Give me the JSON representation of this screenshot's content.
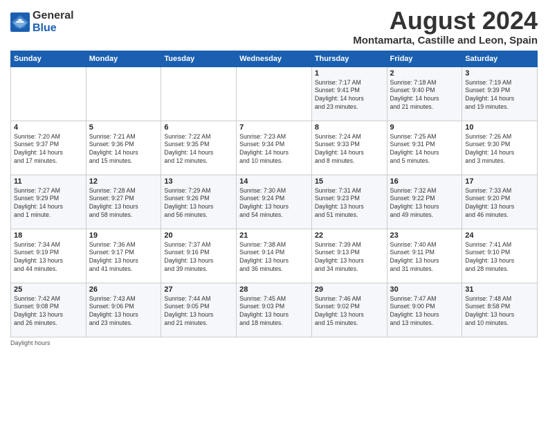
{
  "logo": {
    "general": "General",
    "blue": "Blue"
  },
  "header": {
    "month": "August 2024",
    "location": "Montamarta, Castille and Leon, Spain"
  },
  "weekdays": [
    "Sunday",
    "Monday",
    "Tuesday",
    "Wednesday",
    "Thursday",
    "Friday",
    "Saturday"
  ],
  "weeks": [
    [
      {
        "day": "",
        "info": ""
      },
      {
        "day": "",
        "info": ""
      },
      {
        "day": "",
        "info": ""
      },
      {
        "day": "",
        "info": ""
      },
      {
        "day": "1",
        "info": "Sunrise: 7:17 AM\nSunset: 9:41 PM\nDaylight: 14 hours\nand 23 minutes."
      },
      {
        "day": "2",
        "info": "Sunrise: 7:18 AM\nSunset: 9:40 PM\nDaylight: 14 hours\nand 21 minutes."
      },
      {
        "day": "3",
        "info": "Sunrise: 7:19 AM\nSunset: 9:39 PM\nDaylight: 14 hours\nand 19 minutes."
      }
    ],
    [
      {
        "day": "4",
        "info": "Sunrise: 7:20 AM\nSunset: 9:37 PM\nDaylight: 14 hours\nand 17 minutes."
      },
      {
        "day": "5",
        "info": "Sunrise: 7:21 AM\nSunset: 9:36 PM\nDaylight: 14 hours\nand 15 minutes."
      },
      {
        "day": "6",
        "info": "Sunrise: 7:22 AM\nSunset: 9:35 PM\nDaylight: 14 hours\nand 12 minutes."
      },
      {
        "day": "7",
        "info": "Sunrise: 7:23 AM\nSunset: 9:34 PM\nDaylight: 14 hours\nand 10 minutes."
      },
      {
        "day": "8",
        "info": "Sunrise: 7:24 AM\nSunset: 9:33 PM\nDaylight: 14 hours\nand 8 minutes."
      },
      {
        "day": "9",
        "info": "Sunrise: 7:25 AM\nSunset: 9:31 PM\nDaylight: 14 hours\nand 5 minutes."
      },
      {
        "day": "10",
        "info": "Sunrise: 7:26 AM\nSunset: 9:30 PM\nDaylight: 14 hours\nand 3 minutes."
      }
    ],
    [
      {
        "day": "11",
        "info": "Sunrise: 7:27 AM\nSunset: 9:29 PM\nDaylight: 14 hours\nand 1 minute."
      },
      {
        "day": "12",
        "info": "Sunrise: 7:28 AM\nSunset: 9:27 PM\nDaylight: 13 hours\nand 58 minutes."
      },
      {
        "day": "13",
        "info": "Sunrise: 7:29 AM\nSunset: 9:26 PM\nDaylight: 13 hours\nand 56 minutes."
      },
      {
        "day": "14",
        "info": "Sunrise: 7:30 AM\nSunset: 9:24 PM\nDaylight: 13 hours\nand 54 minutes."
      },
      {
        "day": "15",
        "info": "Sunrise: 7:31 AM\nSunset: 9:23 PM\nDaylight: 13 hours\nand 51 minutes."
      },
      {
        "day": "16",
        "info": "Sunrise: 7:32 AM\nSunset: 9:22 PM\nDaylight: 13 hours\nand 49 minutes."
      },
      {
        "day": "17",
        "info": "Sunrise: 7:33 AM\nSunset: 9:20 PM\nDaylight: 13 hours\nand 46 minutes."
      }
    ],
    [
      {
        "day": "18",
        "info": "Sunrise: 7:34 AM\nSunset: 9:19 PM\nDaylight: 13 hours\nand 44 minutes."
      },
      {
        "day": "19",
        "info": "Sunrise: 7:36 AM\nSunset: 9:17 PM\nDaylight: 13 hours\nand 41 minutes."
      },
      {
        "day": "20",
        "info": "Sunrise: 7:37 AM\nSunset: 9:16 PM\nDaylight: 13 hours\nand 39 minutes."
      },
      {
        "day": "21",
        "info": "Sunrise: 7:38 AM\nSunset: 9:14 PM\nDaylight: 13 hours\nand 36 minutes."
      },
      {
        "day": "22",
        "info": "Sunrise: 7:39 AM\nSunset: 9:13 PM\nDaylight: 13 hours\nand 34 minutes."
      },
      {
        "day": "23",
        "info": "Sunrise: 7:40 AM\nSunset: 9:11 PM\nDaylight: 13 hours\nand 31 minutes."
      },
      {
        "day": "24",
        "info": "Sunrise: 7:41 AM\nSunset: 9:10 PM\nDaylight: 13 hours\nand 28 minutes."
      }
    ],
    [
      {
        "day": "25",
        "info": "Sunrise: 7:42 AM\nSunset: 9:08 PM\nDaylight: 13 hours\nand 26 minutes."
      },
      {
        "day": "26",
        "info": "Sunrise: 7:43 AM\nSunset: 9:06 PM\nDaylight: 13 hours\nand 23 minutes."
      },
      {
        "day": "27",
        "info": "Sunrise: 7:44 AM\nSunset: 9:05 PM\nDaylight: 13 hours\nand 21 minutes."
      },
      {
        "day": "28",
        "info": "Sunrise: 7:45 AM\nSunset: 9:03 PM\nDaylight: 13 hours\nand 18 minutes."
      },
      {
        "day": "29",
        "info": "Sunrise: 7:46 AM\nSunset: 9:02 PM\nDaylight: 13 hours\nand 15 minutes."
      },
      {
        "day": "30",
        "info": "Sunrise: 7:47 AM\nSunset: 9:00 PM\nDaylight: 13 hours\nand 13 minutes."
      },
      {
        "day": "31",
        "info": "Sunrise: 7:48 AM\nSunset: 8:58 PM\nDaylight: 13 hours\nand 10 minutes."
      }
    ]
  ],
  "footer": {
    "note": "Daylight hours"
  }
}
